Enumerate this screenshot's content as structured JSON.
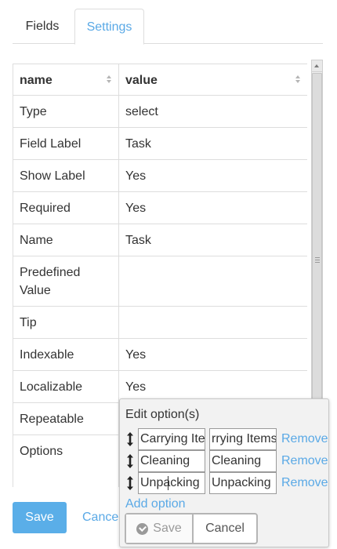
{
  "tabs": [
    {
      "label": "Fields",
      "active": false
    },
    {
      "label": "Settings",
      "active": true
    }
  ],
  "table": {
    "headers": {
      "name": "name",
      "value": "value"
    },
    "rows": [
      {
        "name": "Type",
        "value": "select"
      },
      {
        "name": "Field Label",
        "value": "Task"
      },
      {
        "name": "Show Label",
        "value": "Yes"
      },
      {
        "name": "Required",
        "value": "Yes"
      },
      {
        "name": "Name",
        "value": "Task"
      },
      {
        "name": "Predefined Value",
        "value": ""
      },
      {
        "name": "Tip",
        "value": ""
      },
      {
        "name": "Indexable",
        "value": "Yes"
      },
      {
        "name": "Localizable",
        "value": "Yes"
      },
      {
        "name": "Repeatable",
        "value": ""
      },
      {
        "name": "Options",
        "value": ""
      }
    ]
  },
  "actions": {
    "save_label": "Save",
    "cancel_label": "Cancel"
  },
  "popover": {
    "title": "Edit option(s)",
    "options": [
      {
        "label": "Carrying Ite",
        "value": "rrying Items",
        "remove_label": "Remove"
      },
      {
        "label": "Cleaning",
        "value": "Cleaning",
        "remove_label": "Remove"
      },
      {
        "label": "Unpacking",
        "value": "Unpacking",
        "remove_label": "Remove"
      }
    ],
    "add_option_label": "Add option",
    "save_label": "Save",
    "cancel_label": "Cancel"
  },
  "colors": {
    "accent": "#5aa9e6",
    "primary_button": "#5aaee8",
    "border": "#dddddd"
  }
}
